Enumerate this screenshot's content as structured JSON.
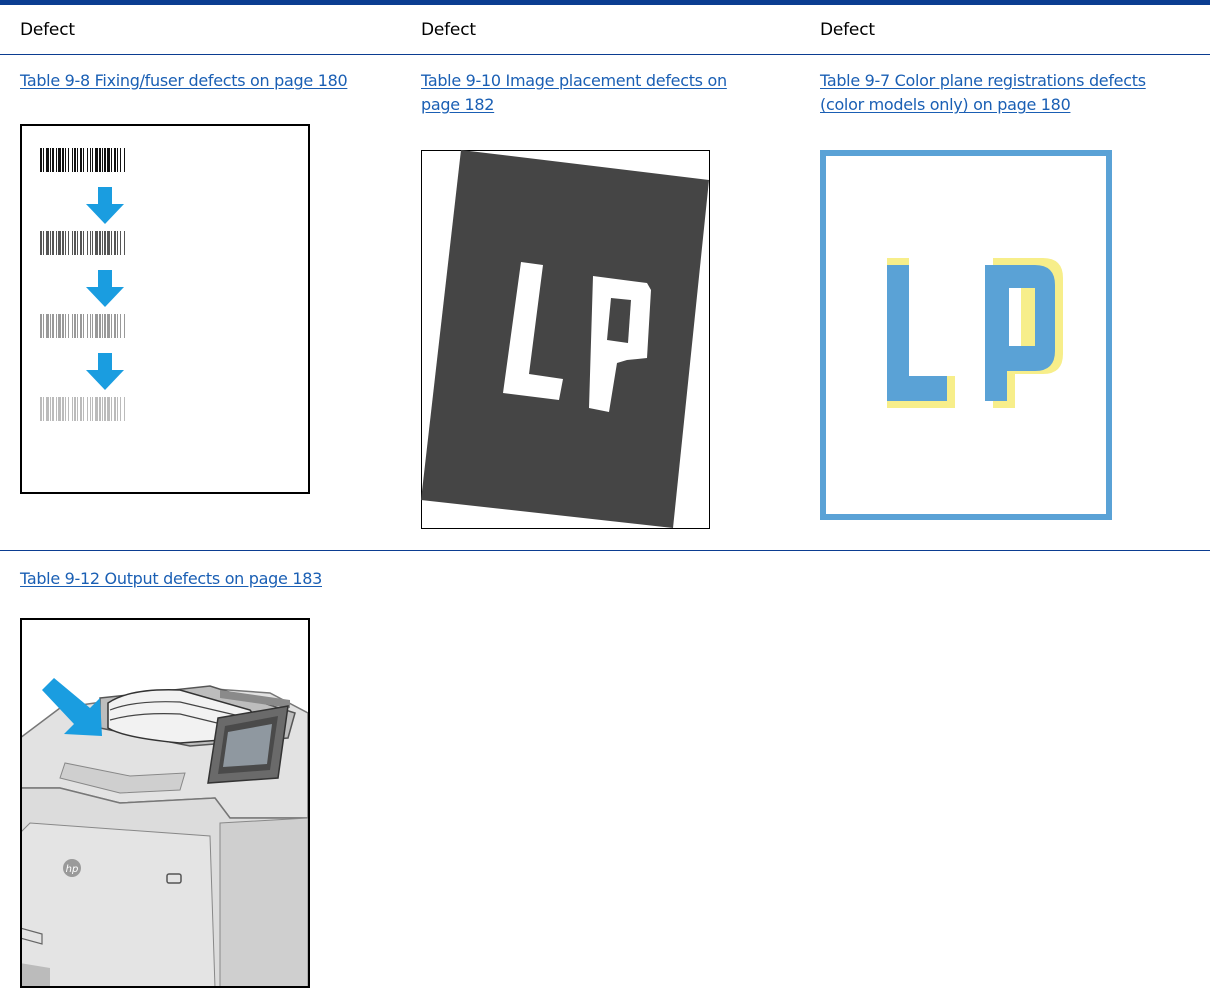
{
  "table": {
    "headers": [
      "Defect",
      "Defect",
      "Defect"
    ],
    "row1": {
      "col1_link": "Table 9-8 Fixing/fuser defects on page 180",
      "col2_link": "Table 9-10 Image placement defects on page 182",
      "col3_link": "Table 9-7 Color plane registrations defects (color models only) on page 180"
    },
    "row2": {
      "col1_link": "Table 9-12 Output defects on page 183"
    }
  },
  "images": {
    "fuser": {
      "name": "fuser-defect-illustration"
    },
    "placement": {
      "name": "image-placement-defect-illustration",
      "letters": "LP"
    },
    "registration": {
      "name": "color-registration-defect-illustration",
      "letters": "LP"
    },
    "output": {
      "name": "output-defect-printer-illustration",
      "logo": "hp"
    }
  },
  "colors": {
    "rule": "#0b3d91",
    "link": "#1a5fb4",
    "arrow": "#1a9de0",
    "registration_blue": "#5aa2d6",
    "registration_yellow": "#f7ee8a",
    "placement_dark": "#454545"
  }
}
